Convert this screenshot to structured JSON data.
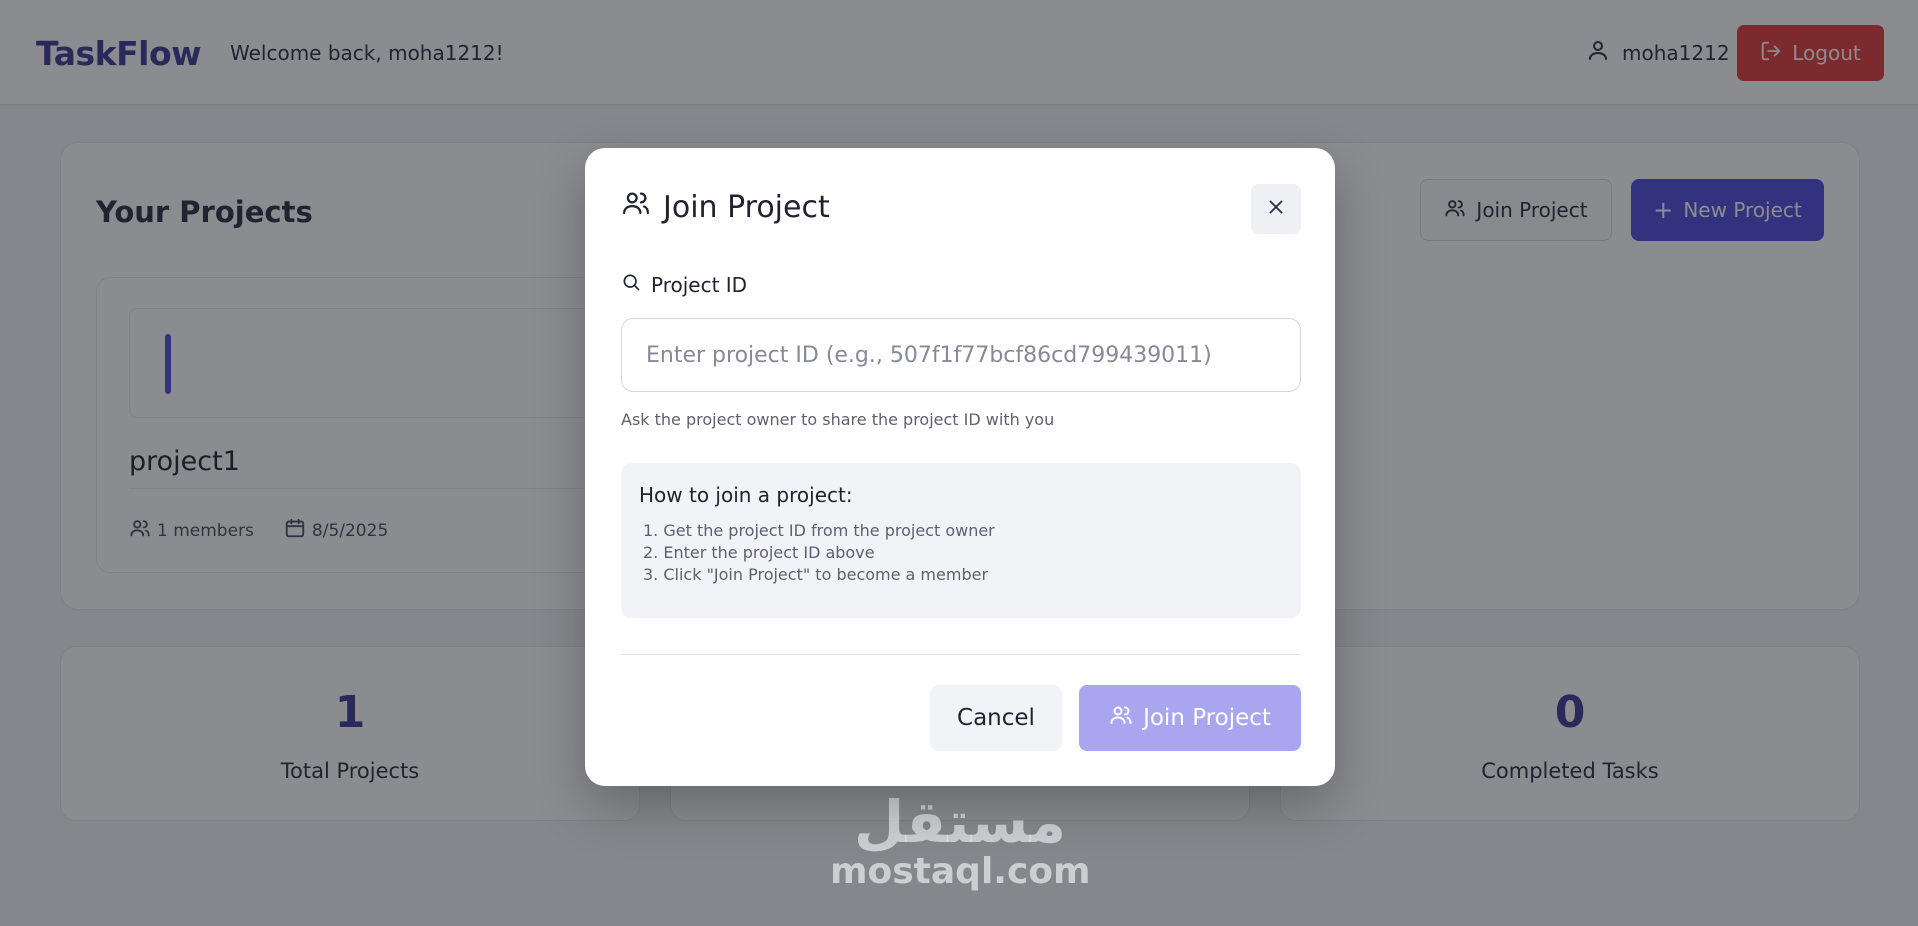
{
  "header": {
    "brand": "TaskFlow",
    "welcome": "Welcome back, moha1212!",
    "username": "moha1212",
    "logout_label": "Logout"
  },
  "projects_panel": {
    "title": "Your Projects",
    "join_button": "Join Project",
    "new_button": "New Project",
    "projects": [
      {
        "name": "project1",
        "members": "1 members",
        "date": "8/5/2025"
      }
    ]
  },
  "stats": [
    {
      "value": "1",
      "label": "Total Projects"
    },
    {
      "value": "0",
      "label": "Completed Tasks"
    }
  ],
  "modal": {
    "title": "Join Project",
    "field_label": "Project ID",
    "input_placeholder": "Enter project ID (e.g., 507f1f77bcf86cd799439011)",
    "input_value": "",
    "hint": "Ask the project owner to share the project ID with you",
    "howto_title": "How to join a project:",
    "steps": [
      "1. Get the project ID from the project owner",
      "2. Enter the project ID above",
      "3. Click \"Join Project\" to become a member"
    ],
    "cancel_label": "Cancel",
    "join_label": "Join Project"
  },
  "watermark": {
    "arabic": "مستقل",
    "latin": "mostaql.com"
  },
  "colors": {
    "brand": "#3c3a92",
    "accent": "#4f4bdc",
    "danger": "#e23a3a",
    "join_disabled": "#a9a6f0"
  }
}
